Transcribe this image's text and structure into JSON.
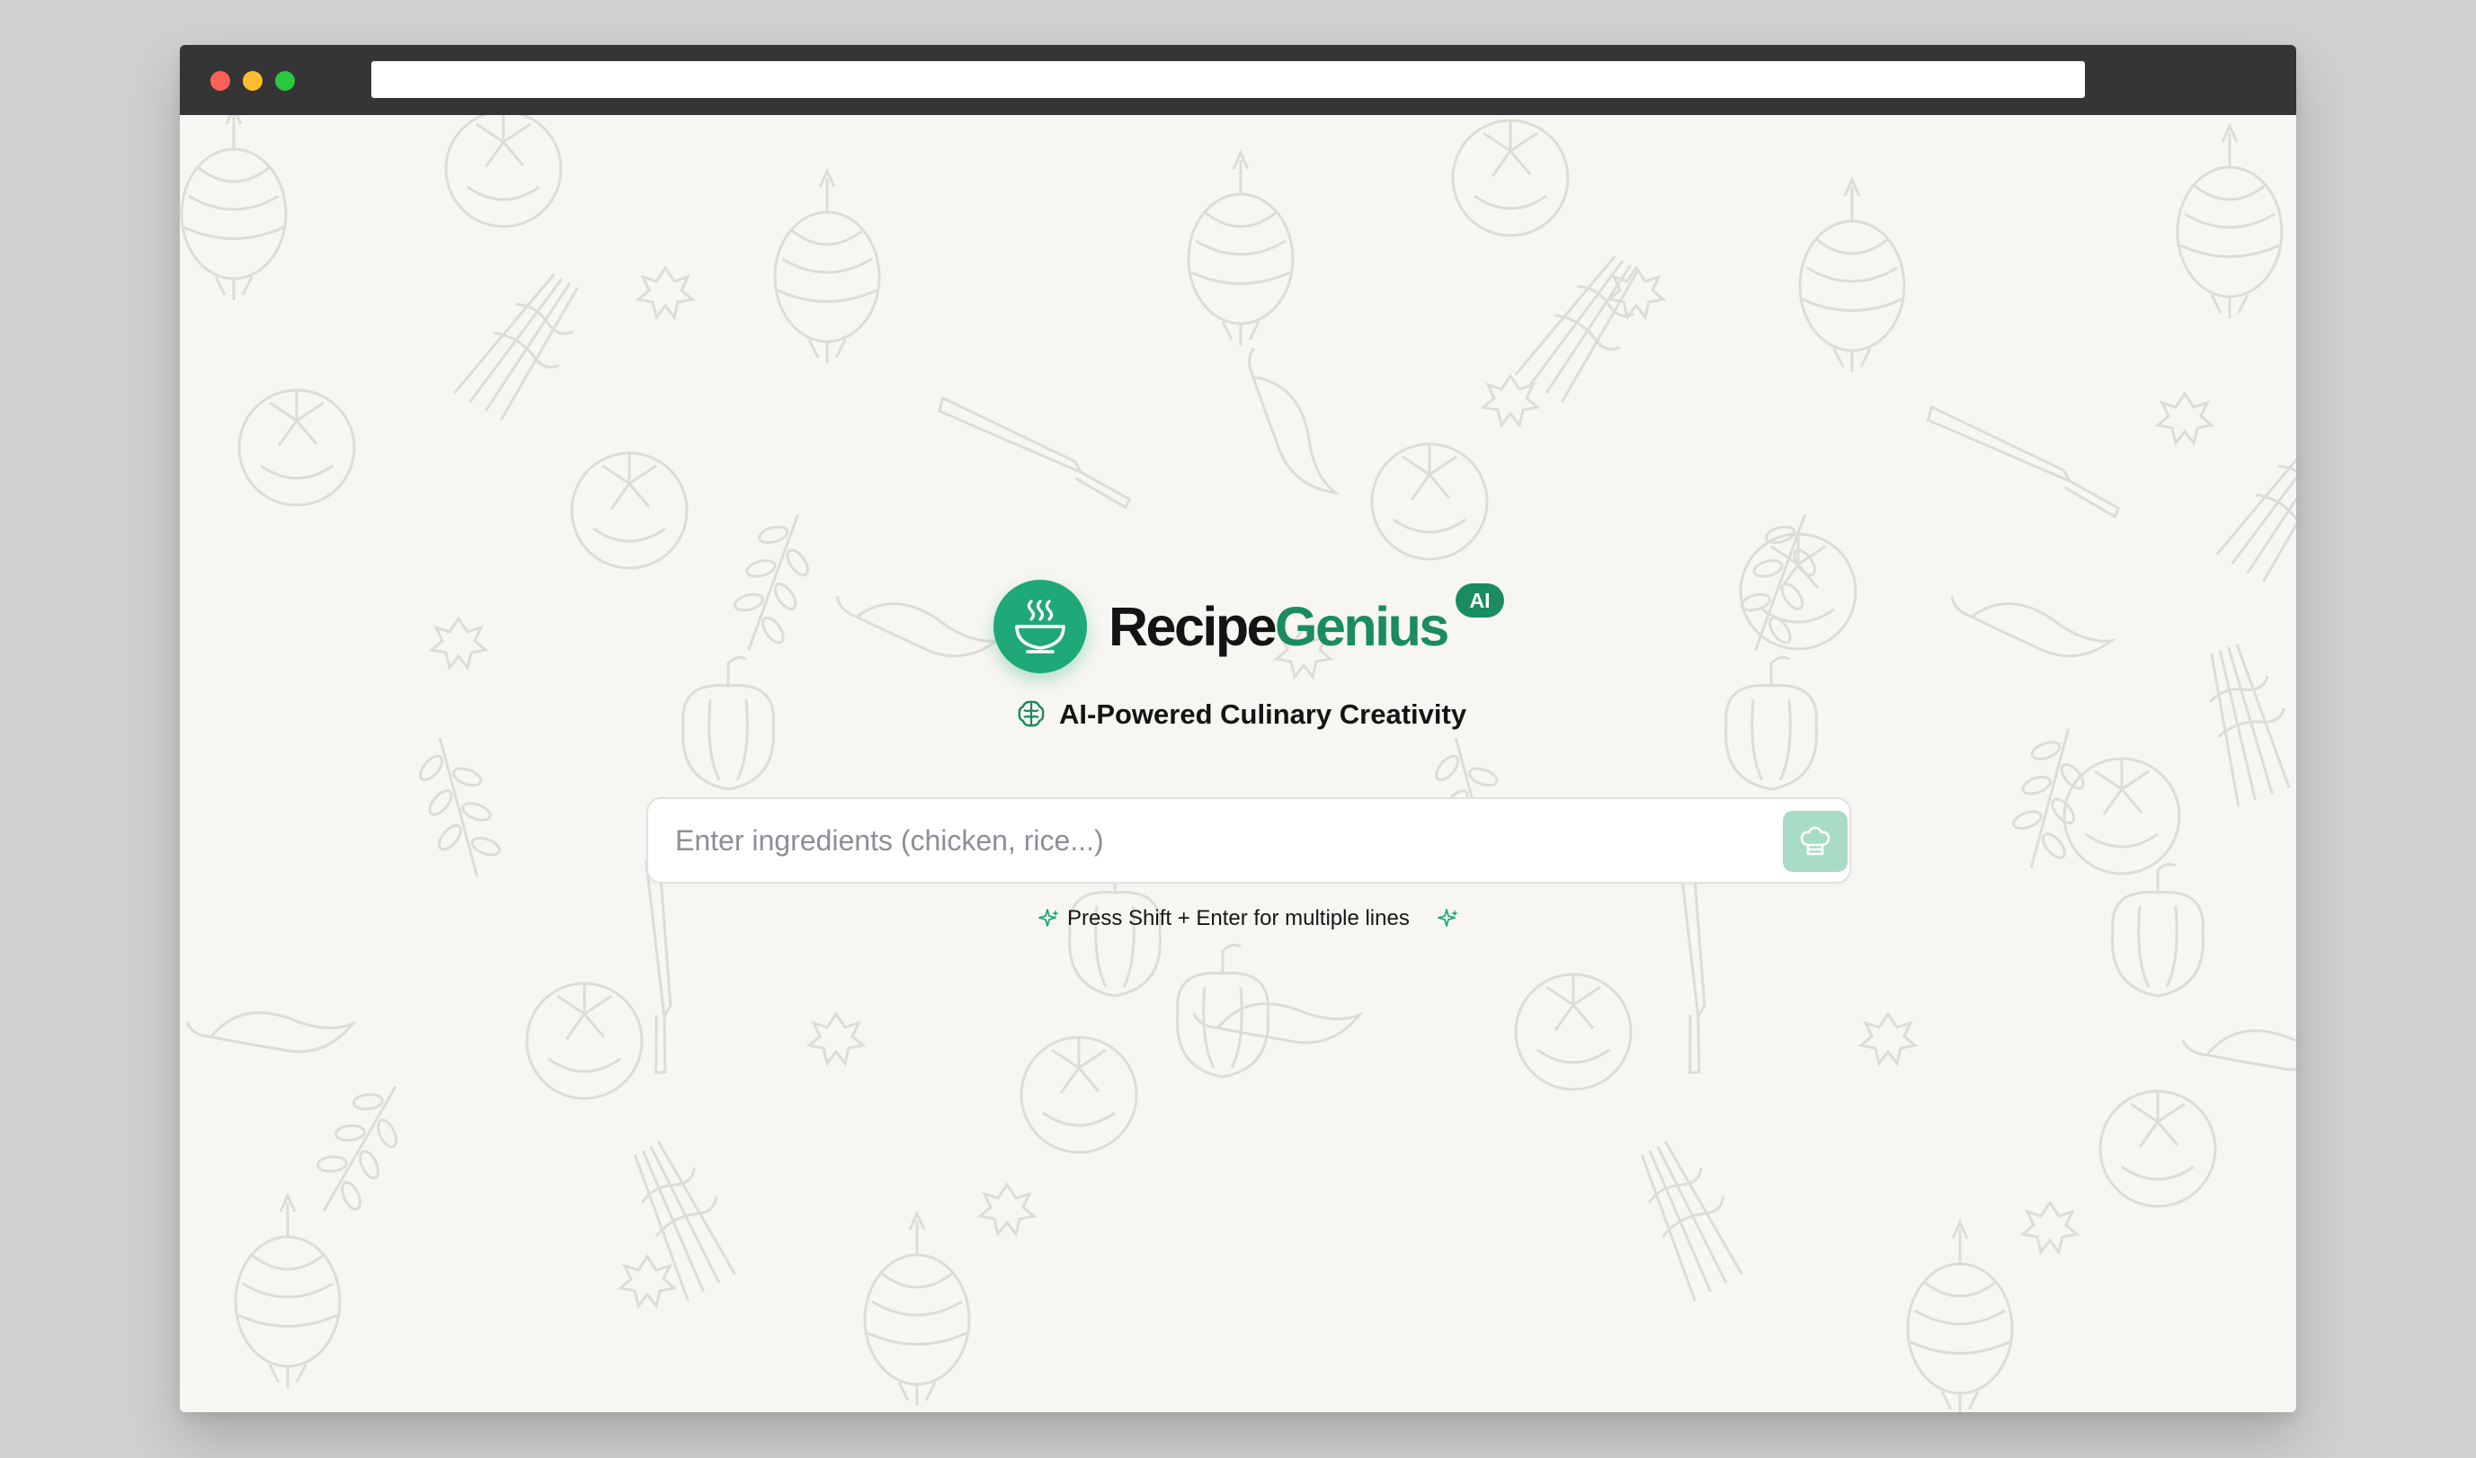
{
  "app": {
    "brand_part1": "Recipe",
    "brand_part2": "Genius",
    "badge": "AI",
    "tagline": "AI-Powered Culinary Creativity",
    "logo_icon": "steaming-bowl-icon",
    "tagline_icon": "brain-icon"
  },
  "search": {
    "value": "",
    "placeholder": "Enter ingredients (chicken, rice...)",
    "submit_icon": "chef-hat-icon"
  },
  "hint": {
    "text": "Press Shift + Enter for multiple lines",
    "icon": "sparkle-icon"
  },
  "window": {
    "controls": [
      "close",
      "minimize",
      "maximize"
    ],
    "address_value": ""
  },
  "colors": {
    "brand_green": "#1a8c5f",
    "logo_green": "#1fa878",
    "button_green_disabled": "#a9dcc6",
    "background": "#f8f6f2",
    "titlebar": "#353535"
  }
}
